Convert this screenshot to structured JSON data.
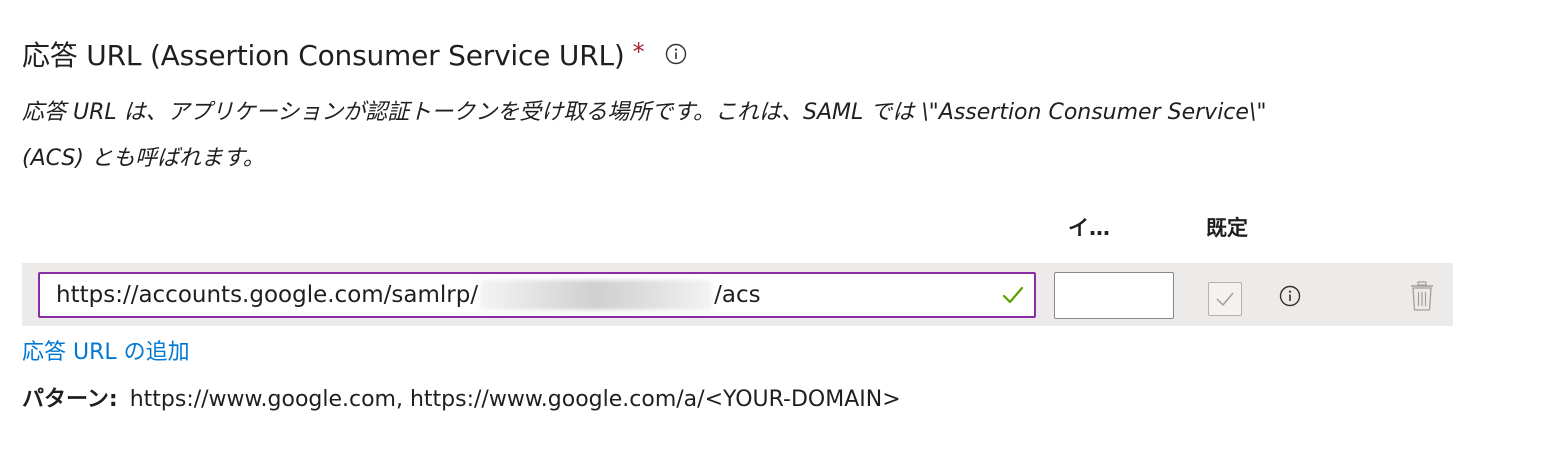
{
  "section": {
    "title": "応答 URL (Assertion Consumer Service URL)",
    "required_mark": "*",
    "info_icon": "info-circle-icon",
    "description_line1": "応答 URL は、アプリケーションが認証トークンを受け取る場所です。これは、SAML では \\\"Assertion Consumer Service\\\"",
    "description_line2": "(ACS) とも呼ばれます。"
  },
  "table": {
    "headers": {
      "index": "イ…",
      "default": "既定"
    },
    "rows": [
      {
        "url_prefix": "https://accounts.google.com/samlrp/",
        "url_redacted": true,
        "url_suffix": "/acs",
        "index_value": "",
        "default_checked": false,
        "valid": true
      }
    ]
  },
  "add_link": {
    "label": "応答 URL の追加"
  },
  "pattern": {
    "label": "パターン:",
    "value": "https://www.google.com, https://www.google.com/a/<YOUR-DOMAIN>"
  },
  "colors": {
    "accent": "#0078d4",
    "focus_border": "#8a2da5",
    "required": "#a4262c",
    "valid": "#57a300",
    "row_background": "#edebe9"
  },
  "icons": {
    "valid": "checkmark-icon",
    "checkbox": "checkbox-icon",
    "row_info": "info-circle-icon",
    "delete": "trash-icon"
  }
}
